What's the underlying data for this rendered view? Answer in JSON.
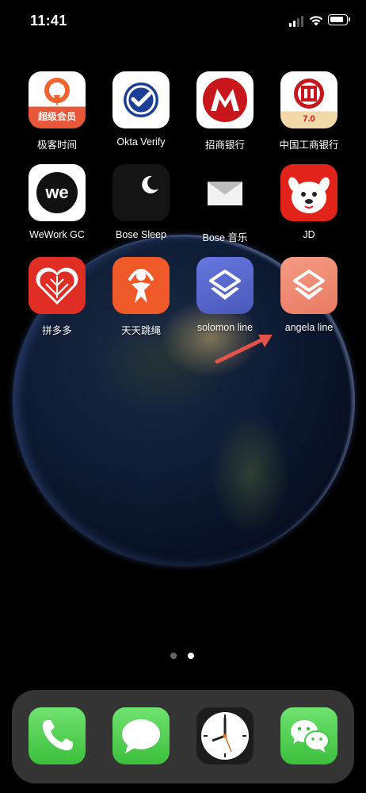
{
  "status_bar": {
    "time": "11:41",
    "signal_bars_active": 2,
    "signal_bars_total": 4
  },
  "apps": [
    {
      "label": "极客时间",
      "icon": "geektime-icon",
      "badge_text": "超级会员"
    },
    {
      "label": "Okta Verify",
      "icon": "okta-verify-icon"
    },
    {
      "label": "招商银行",
      "icon": "cmb-icon"
    },
    {
      "label": "中国工商银行",
      "icon": "icbc-icon",
      "version_text": "7.0"
    },
    {
      "label": "WeWork GC",
      "icon": "wework-icon",
      "logo_text": "we"
    },
    {
      "label": "Bose Sleep",
      "icon": "bose-sleep-icon"
    },
    {
      "label": "Bose 音乐",
      "icon": "bose-music-icon"
    },
    {
      "label": "JD",
      "icon": "jd-icon"
    },
    {
      "label": "拼多多",
      "icon": "pinduoduo-icon"
    },
    {
      "label": "天天跳绳",
      "icon": "tiantian-tiaosheng-icon"
    },
    {
      "label": "solomon line",
      "icon": "shortcuts-icon"
    },
    {
      "label": "angela line",
      "icon": "shortcuts-icon"
    }
  ],
  "page_indicator": {
    "total": 2,
    "current": 2
  },
  "dock": [
    {
      "name": "Phone",
      "icon": "phone-icon"
    },
    {
      "name": "Messages",
      "icon": "messages-icon"
    },
    {
      "name": "Clock",
      "icon": "clock-icon"
    },
    {
      "name": "WeChat",
      "icon": "wechat-icon"
    }
  ],
  "colors": {
    "arrow": "#e2534a",
    "shortcuts_blue": "#5a6bd0",
    "shortcuts_salmon": "#ef8a73",
    "cmb_red": "#c8161d",
    "jd_red": "#e2231a",
    "dock_green": "#4cd964"
  }
}
